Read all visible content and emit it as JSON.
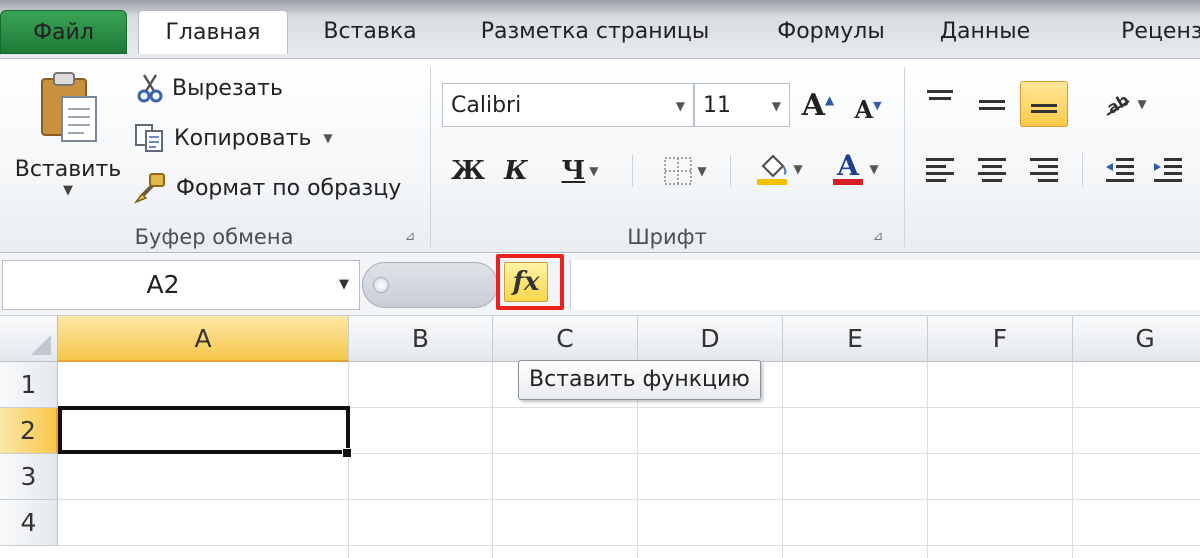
{
  "tabs": {
    "file": "Файл",
    "home": "Главная",
    "insert": "Вставка",
    "page_layout": "Разметка страницы",
    "formulas": "Формулы",
    "data": "Данные",
    "review": "Рецензи"
  },
  "clipboard": {
    "paste": "Вставить",
    "cut": "Вырезать",
    "copy": "Копировать",
    "format_painter": "Формат по образцу",
    "group_label": "Буфер обмена"
  },
  "font": {
    "name": "Calibri",
    "size": "11",
    "bold": "Ж",
    "italic": "К",
    "underline": "Ч",
    "group_label": "Шрифт",
    "font_color": "#d42020",
    "fill_color": "#f2c200"
  },
  "formula_bar": {
    "name_box": "A2",
    "fx": "fx",
    "formula": ""
  },
  "grid": {
    "columns": [
      "A",
      "B",
      "C",
      "D",
      "E",
      "F",
      "G"
    ],
    "rows": [
      "1",
      "2",
      "3",
      "4"
    ],
    "selected_column": "A",
    "selected_row": "2"
  },
  "tooltip": "Вставить функцию",
  "colors": {
    "file_tab": "#1d7a36",
    "selection_header": "#f6c64a",
    "highlight_box": "#e8211c"
  }
}
